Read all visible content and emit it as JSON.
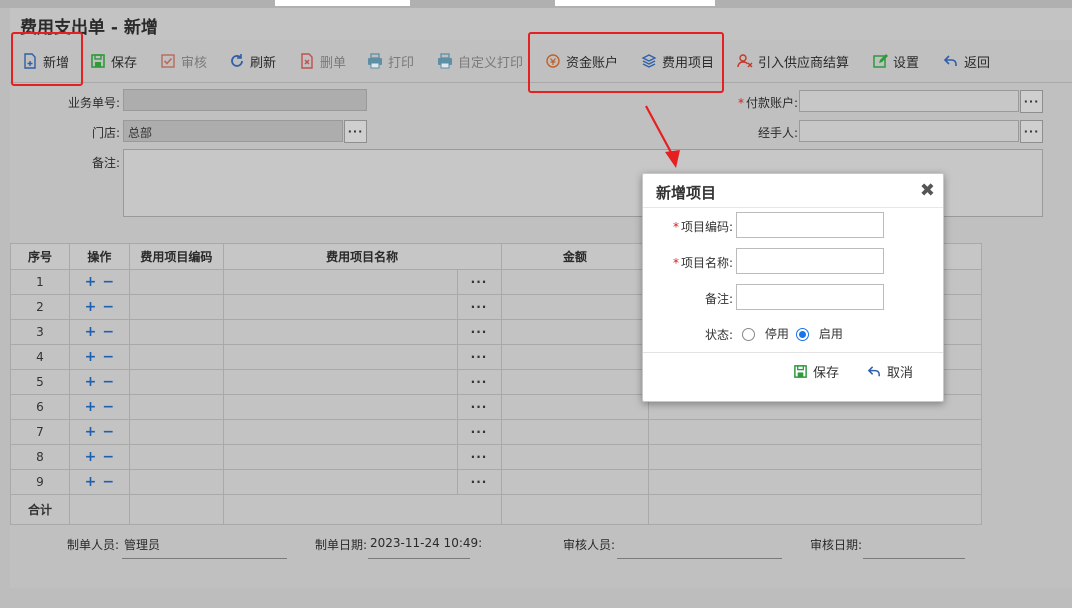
{
  "window": {
    "title": "费用支出单 - 新增"
  },
  "toolbar": {
    "new": "新增",
    "save": "保存",
    "audit": "审核",
    "refresh": "刷新",
    "delete": "删单",
    "print": "打印",
    "custom_print": "自定义打印",
    "fund_account": "资金账户",
    "expense_item": "费用项目",
    "import_supplier": "引入供应商结算",
    "settings": "设置",
    "back": "返回"
  },
  "form": {
    "doc_no_label": "业务单号:",
    "doc_no_value": "",
    "store_label": "门店:",
    "store_value": "总部",
    "remark_label": "备注:",
    "pay_account_label": "付款账户:",
    "pay_account_value": "",
    "handler_label": "经手人:",
    "handler_value": "",
    "required_mark": "*",
    "lookup_glyph": "···"
  },
  "grid": {
    "headers": [
      "序号",
      "操作",
      "费用项目编码",
      "费用项目名称",
      "金额",
      ""
    ],
    "rows": [
      "1",
      "2",
      "3",
      "4",
      "5",
      "6",
      "7",
      "8",
      "9"
    ],
    "add_glyph": "+",
    "remove_glyph": "−",
    "total_label": "合计"
  },
  "footer": {
    "creator_label": "制单人员:",
    "creator_value": "管理员",
    "create_date_label": "制单日期:",
    "create_date_value": "2023-11-24 10:49:",
    "auditor_label": "审核人员:",
    "auditor_value": "",
    "audit_date_label": "审核日期:",
    "audit_date_value": ""
  },
  "modal": {
    "title": "新增项目",
    "close_glyph": "✖",
    "code_label": "项目编码:",
    "name_label": "项目名称:",
    "remark_label": "备注:",
    "status_label": "状态:",
    "status_disabled": "停用",
    "status_enabled": "启用",
    "status_selected": "启用",
    "save": "保存",
    "cancel": "取消"
  },
  "colors": {
    "highlight": "#e62020",
    "accent_blue": "#1a73e8",
    "save_green": "#2e9a3c"
  },
  "icons": [
    "new-doc-icon",
    "save-icon",
    "audit-check-icon",
    "refresh-icon",
    "delete-doc-icon",
    "print-icon",
    "fund-account-icon",
    "expense-item-icon",
    "import-supplier-icon",
    "settings-edit-icon",
    "back-arrow-icon",
    "close-icon"
  ]
}
